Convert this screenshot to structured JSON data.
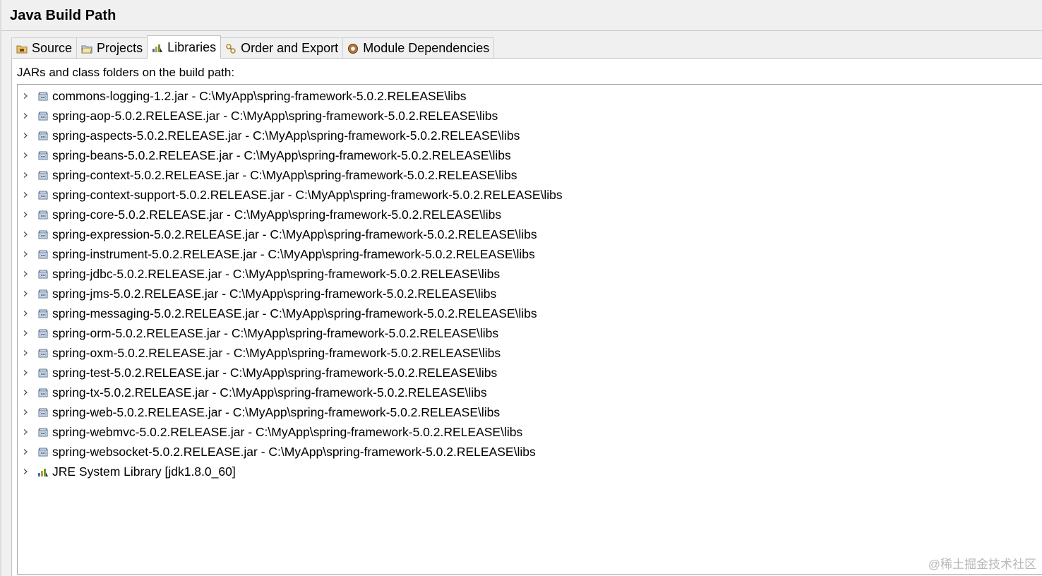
{
  "dialog": {
    "title": "Java Build Path"
  },
  "tabs": [
    {
      "label": "Source",
      "icon": "source-folder-icon",
      "active": false
    },
    {
      "label": "Projects",
      "icon": "projects-folder-icon",
      "active": false
    },
    {
      "label": "Libraries",
      "icon": "libraries-icon",
      "active": true
    },
    {
      "label": "Order and Export",
      "icon": "order-export-icon",
      "active": false
    },
    {
      "label": "Module Dependencies",
      "icon": "module-icon",
      "active": false
    }
  ],
  "libraries": {
    "label": "JARs and class folders on the build path:",
    "items": [
      {
        "text": "commons-logging-1.2.jar - C:\\MyApp\\spring-framework-5.0.2.RELEASE\\libs",
        "icon": "jar-icon"
      },
      {
        "text": "spring-aop-5.0.2.RELEASE.jar - C:\\MyApp\\spring-framework-5.0.2.RELEASE\\libs",
        "icon": "jar-icon"
      },
      {
        "text": "spring-aspects-5.0.2.RELEASE.jar - C:\\MyApp\\spring-framework-5.0.2.RELEASE\\libs",
        "icon": "jar-icon"
      },
      {
        "text": "spring-beans-5.0.2.RELEASE.jar - C:\\MyApp\\spring-framework-5.0.2.RELEASE\\libs",
        "icon": "jar-icon"
      },
      {
        "text": "spring-context-5.0.2.RELEASE.jar - C:\\MyApp\\spring-framework-5.0.2.RELEASE\\libs",
        "icon": "jar-icon"
      },
      {
        "text": "spring-context-support-5.0.2.RELEASE.jar - C:\\MyApp\\spring-framework-5.0.2.RELEASE\\libs",
        "icon": "jar-icon"
      },
      {
        "text": "spring-core-5.0.2.RELEASE.jar - C:\\MyApp\\spring-framework-5.0.2.RELEASE\\libs",
        "icon": "jar-icon"
      },
      {
        "text": "spring-expression-5.0.2.RELEASE.jar - C:\\MyApp\\spring-framework-5.0.2.RELEASE\\libs",
        "icon": "jar-icon"
      },
      {
        "text": "spring-instrument-5.0.2.RELEASE.jar - C:\\MyApp\\spring-framework-5.0.2.RELEASE\\libs",
        "icon": "jar-icon"
      },
      {
        "text": "spring-jdbc-5.0.2.RELEASE.jar - C:\\MyApp\\spring-framework-5.0.2.RELEASE\\libs",
        "icon": "jar-icon"
      },
      {
        "text": "spring-jms-5.0.2.RELEASE.jar - C:\\MyApp\\spring-framework-5.0.2.RELEASE\\libs",
        "icon": "jar-icon"
      },
      {
        "text": "spring-messaging-5.0.2.RELEASE.jar - C:\\MyApp\\spring-framework-5.0.2.RELEASE\\libs",
        "icon": "jar-icon"
      },
      {
        "text": "spring-orm-5.0.2.RELEASE.jar - C:\\MyApp\\spring-framework-5.0.2.RELEASE\\libs",
        "icon": "jar-icon"
      },
      {
        "text": "spring-oxm-5.0.2.RELEASE.jar - C:\\MyApp\\spring-framework-5.0.2.RELEASE\\libs",
        "icon": "jar-icon"
      },
      {
        "text": "spring-test-5.0.2.RELEASE.jar - C:\\MyApp\\spring-framework-5.0.2.RELEASE\\libs",
        "icon": "jar-icon"
      },
      {
        "text": "spring-tx-5.0.2.RELEASE.jar - C:\\MyApp\\spring-framework-5.0.2.RELEASE\\libs",
        "icon": "jar-icon"
      },
      {
        "text": "spring-web-5.0.2.RELEASE.jar - C:\\MyApp\\spring-framework-5.0.2.RELEASE\\libs",
        "icon": "jar-icon"
      },
      {
        "text": "spring-webmvc-5.0.2.RELEASE.jar - C:\\MyApp\\spring-framework-5.0.2.RELEASE\\libs",
        "icon": "jar-icon"
      },
      {
        "text": "spring-websocket-5.0.2.RELEASE.jar - C:\\MyApp\\spring-framework-5.0.2.RELEASE\\libs",
        "icon": "jar-icon"
      },
      {
        "text": "JRE System Library [jdk1.8.0_60]",
        "icon": "jre-library-icon"
      }
    ]
  },
  "watermark": "@稀土掘金技术社区"
}
